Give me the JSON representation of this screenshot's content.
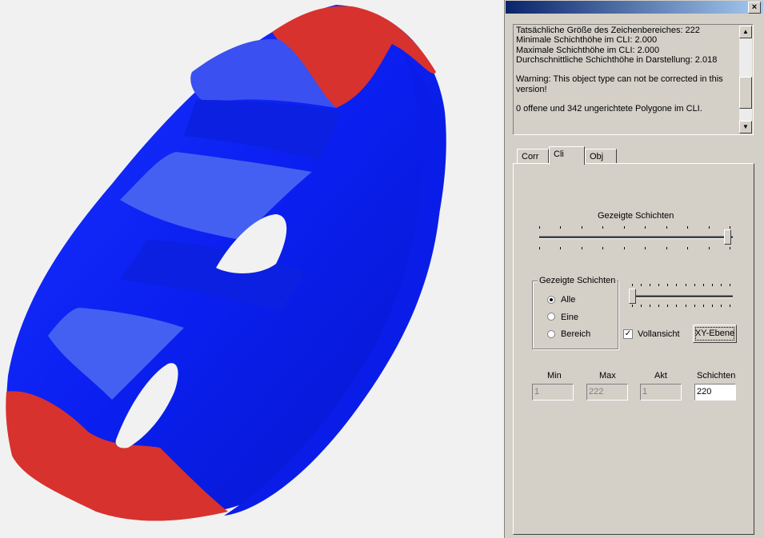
{
  "viewport": {
    "colors": {
      "blue": "#0a1ff0",
      "red": "#d8322e",
      "background": "#f1f1f1"
    }
  },
  "panel": {
    "title": "",
    "close_label": "×",
    "log": {
      "lines": "Tatsächliche Größe des Zeichenbereiches: 222\nMinimale Schichthöhe im CLI: 2.000\nMaximale Schichthöhe im CLI: 2.000\nDurchschnittliche Schichthöhe in Darstellung: 2.018\n\nWarning: This object type can not be corrected in this version!\n\n0 offene und 342 ungerichtete Polygone im CLI."
    },
    "tabs": [
      "Corr",
      "Cli",
      "Obj"
    ],
    "active_tab": "Cli",
    "shown_layers_label": "Gezeigte Schichten",
    "group_title": "Gezeigte Schichten",
    "radios": [
      "Alle",
      "Eine",
      "Bereich"
    ],
    "radio_selected": "Alle",
    "full_view_label": "Vollansicht",
    "full_view_checked": true,
    "xy_button_label": "XY-Ebene",
    "fields": {
      "min_label": "Min",
      "min_value": "1",
      "max_label": "Max",
      "max_value": "222",
      "akt_label": "Akt",
      "akt_value": "1",
      "layers_label": "Schichten",
      "layers_value": "220"
    },
    "slider_main_fraction": 1.0,
    "slider_secondary_fraction": 0.0
  }
}
